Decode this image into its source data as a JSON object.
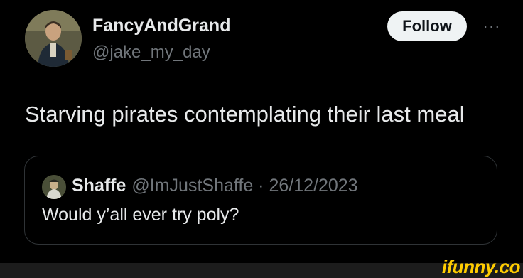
{
  "author": {
    "display_name": "FancyAndGrand",
    "handle": "@jake_my_day",
    "avatar_icon": "profile-photo"
  },
  "actions": {
    "follow_label": "Follow",
    "more_label": "···"
  },
  "tweet": {
    "text": "Starving pirates contemplating their last meal"
  },
  "quote": {
    "name": "Shaffe",
    "handle_date": "@ImJustShaffe · 26/12/2023",
    "text": "Would y’all ever try poly?",
    "avatar_icon": "profile-photo"
  },
  "watermark": "ifunny.co",
  "colors": {
    "background": "#000000",
    "text": "#e7e9ea",
    "secondary_text": "#71767b",
    "follow_button": "#eff3f4",
    "card_border": "#2f3336",
    "watermark": "#ffcc00"
  }
}
